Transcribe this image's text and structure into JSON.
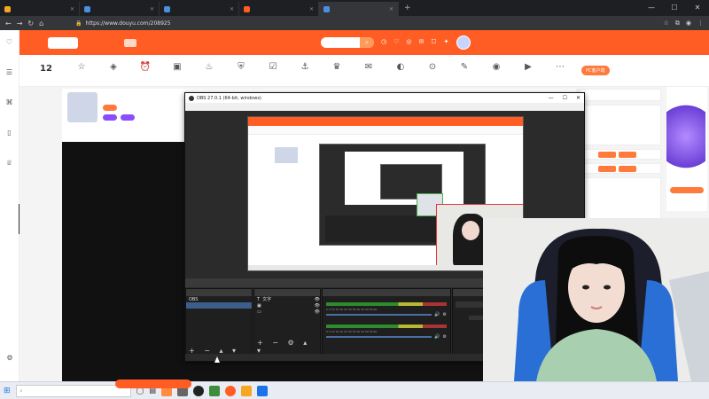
{
  "browser": {
    "tabs": [
      {
        "label": "",
        "color": "#f5a623",
        "active": false
      },
      {
        "label": "",
        "color": "#4a90e2",
        "active": false
      },
      {
        "label": "",
        "color": "#4a90e2",
        "active": false
      },
      {
        "label": "",
        "color": "#ff5d23",
        "active": false
      },
      {
        "label": "",
        "color": "#4a90e2",
        "active": true
      }
    ],
    "url": "https://www.douyu.com/208925"
  },
  "left_sidebar": [
    {
      "label": "",
      "icon": "heart-icon"
    },
    {
      "label": "",
      "icon": "list-icon"
    },
    {
      "label": "",
      "icon": "gamepad-icon"
    },
    {
      "label": "",
      "icon": "mobile-game-icon"
    },
    {
      "label": "",
      "icon": "trophy-icon"
    }
  ],
  "site_header": {
    "logo": "",
    "logo2": "",
    "nav": [
      "",
      "",
      "",
      "",
      "",
      "",
      ""
    ],
    "active_nav_index": 1,
    "search_placeholder": "",
    "icons": [
      {
        "label": "",
        "icon": "history-icon"
      },
      {
        "label": "",
        "icon": "follow-icon"
      },
      {
        "label": "",
        "icon": "broadcast-icon"
      },
      {
        "label": "",
        "icon": "message-icon"
      },
      {
        "label": "",
        "icon": "task-icon"
      },
      {
        "label": "",
        "icon": "creator-icon"
      }
    ],
    "signature": ""
  },
  "sub_bar": {
    "rank_value": "12",
    "rank_label": "",
    "items": [
      {
        "label": "",
        "icon": "☆",
        "badge": ""
      },
      {
        "label": "",
        "icon": "◈",
        "badge": ""
      },
      {
        "label": "",
        "icon": "⏰",
        "badge": ""
      },
      {
        "label": "",
        "icon": "▣",
        "badge": ""
      },
      {
        "label": "",
        "icon": "♨",
        "badge": ""
      },
      {
        "label": "",
        "icon": "⛨",
        "badge": ""
      },
      {
        "label": "",
        "icon": "☑",
        "badge": ""
      },
      {
        "label": "",
        "icon": "⚓",
        "badge": ""
      },
      {
        "label": "",
        "icon": "♛",
        "badge": ""
      },
      {
        "label": "",
        "icon": "✉",
        "badge": ""
      },
      {
        "label": "",
        "icon": "◐",
        "badge": ""
      },
      {
        "label": "",
        "icon": "⊙",
        "badge": ""
      },
      {
        "label": "",
        "icon": "✎",
        "badge": ""
      },
      {
        "label": "",
        "icon": "◉",
        "badge": ""
      },
      {
        "label": "",
        "icon": "▶",
        "badge": ""
      },
      {
        "label": "",
        "icon": "⋯",
        "badge": ""
      }
    ],
    "pc_client": "PC客户端",
    "pc_sub": ""
  },
  "streamer": {
    "title": "",
    "name": "",
    "tags": [
      {
        "label": "",
        "color": "#ff7a3b"
      },
      {
        "label": "",
        "color": "#8a4dff"
      },
      {
        "label": "",
        "color": "#8a4dff"
      }
    ]
  },
  "right_panel": {
    "items": [
      "",
      "",
      "",
      "",
      "",
      ""
    ],
    "buttons": [
      "",
      "",
      "",
      ""
    ],
    "promo_button": ""
  },
  "obs": {
    "title": "OBS 27.0.1 (64-bit, windows)",
    "menu": [
      "",
      "",
      "",
      "",
      "",
      "",
      ""
    ],
    "source_bar": [
      "",
      "",
      ""
    ],
    "docks": {
      "scenes": {
        "title": "",
        "items": [
          "OBS",
          ""
        ]
      },
      "sources": {
        "title": "",
        "items": [
          "文字",
          "",
          ""
        ]
      },
      "mixer": {
        "title": "",
        "channels": [
          "",
          ""
        ]
      },
      "transitions": {
        "title": "",
        "duration_label": "",
        "duration_value": ""
      }
    },
    "meter_scale": "0 5 10 15 20 25 30 35 40 45 50 55 60",
    "status": "LIVE 00:00:00"
  },
  "taskbar": {
    "search_placeholder": "",
    "notification": ""
  }
}
